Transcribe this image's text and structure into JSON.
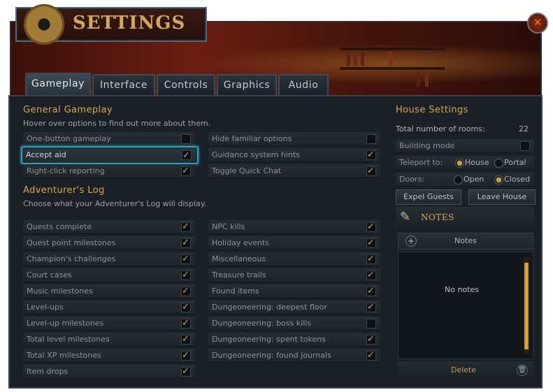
{
  "window": {
    "title": "SETTINGS"
  },
  "tabs": [
    {
      "label": "Gameplay",
      "active": true
    },
    {
      "label": "Interface",
      "active": false
    },
    {
      "label": "Controls",
      "active": false
    },
    {
      "label": "Graphics",
      "active": false
    },
    {
      "label": "Audio",
      "active": false
    }
  ],
  "general": {
    "title": "General Gameplay",
    "subtitle": "Hover over options to find out more about them.",
    "left": [
      {
        "label": "One-button gameplay",
        "checked": false
      },
      {
        "label": "Accept aid",
        "checked": true,
        "highlighted": true
      },
      {
        "label": "Right-click reporting",
        "checked": true
      }
    ],
    "right": [
      {
        "label": "Hide familiar options",
        "checked": false
      },
      {
        "label": "Guidance system hints",
        "checked": true
      },
      {
        "label": "Toggle Quick Chat",
        "checked": true
      }
    ]
  },
  "log": {
    "title": "Adventurer's Log",
    "subtitle": "Choose what your Adventurer's Log will display.",
    "left": [
      {
        "label": "Quests complete",
        "checked": true
      },
      {
        "label": "Quest point milestones",
        "checked": true
      },
      {
        "label": "Champion's challenges",
        "checked": true
      },
      {
        "label": "Court cases",
        "checked": true
      },
      {
        "label": "Music milestones",
        "checked": true
      },
      {
        "label": "Level-ups",
        "checked": true
      },
      {
        "label": "Level-up milestones",
        "checked": true
      },
      {
        "label": "Total level milestones",
        "checked": true
      },
      {
        "label": "Total XP milestones",
        "checked": true
      },
      {
        "label": "Item drops",
        "checked": true
      }
    ],
    "right": [
      {
        "label": "NPC kills",
        "checked": true
      },
      {
        "label": "Holiday events",
        "checked": true
      },
      {
        "label": "Miscellaneous",
        "checked": true
      },
      {
        "label": "Treasure trails",
        "checked": true
      },
      {
        "label": "Found items",
        "checked": true
      },
      {
        "label": "Dungeoneering: deepest floor",
        "checked": true
      },
      {
        "label": "Dungeoneering: boss kills",
        "checked": false
      },
      {
        "label": "Dungeoneering: spent tokens",
        "checked": true
      },
      {
        "label": "Dungeoneering: found journals",
        "checked": true
      }
    ]
  },
  "house": {
    "title": "House Settings",
    "rooms_label": "Total  number of rooms:",
    "rooms_value": "22",
    "building_mode_label": "Building mode",
    "building_mode": false,
    "teleport_label": "Teleport to:",
    "teleport_options": [
      "House",
      "Portal"
    ],
    "teleport_selected": "House",
    "doors_label": "Doors:",
    "doors_options": [
      "Open",
      "Closed"
    ],
    "doors_selected": "Closed",
    "expel_label": "Expel Guests",
    "leave_label": "Leave House"
  },
  "notes": {
    "title": "NOTES",
    "bar_label": "Notes",
    "empty_text": "No notes",
    "delete_label": "Delete"
  },
  "colors": {
    "accent_gold": "#d6a65a",
    "highlight_cyan": "#2aa3c0",
    "panel_bg": "#1b2026"
  }
}
